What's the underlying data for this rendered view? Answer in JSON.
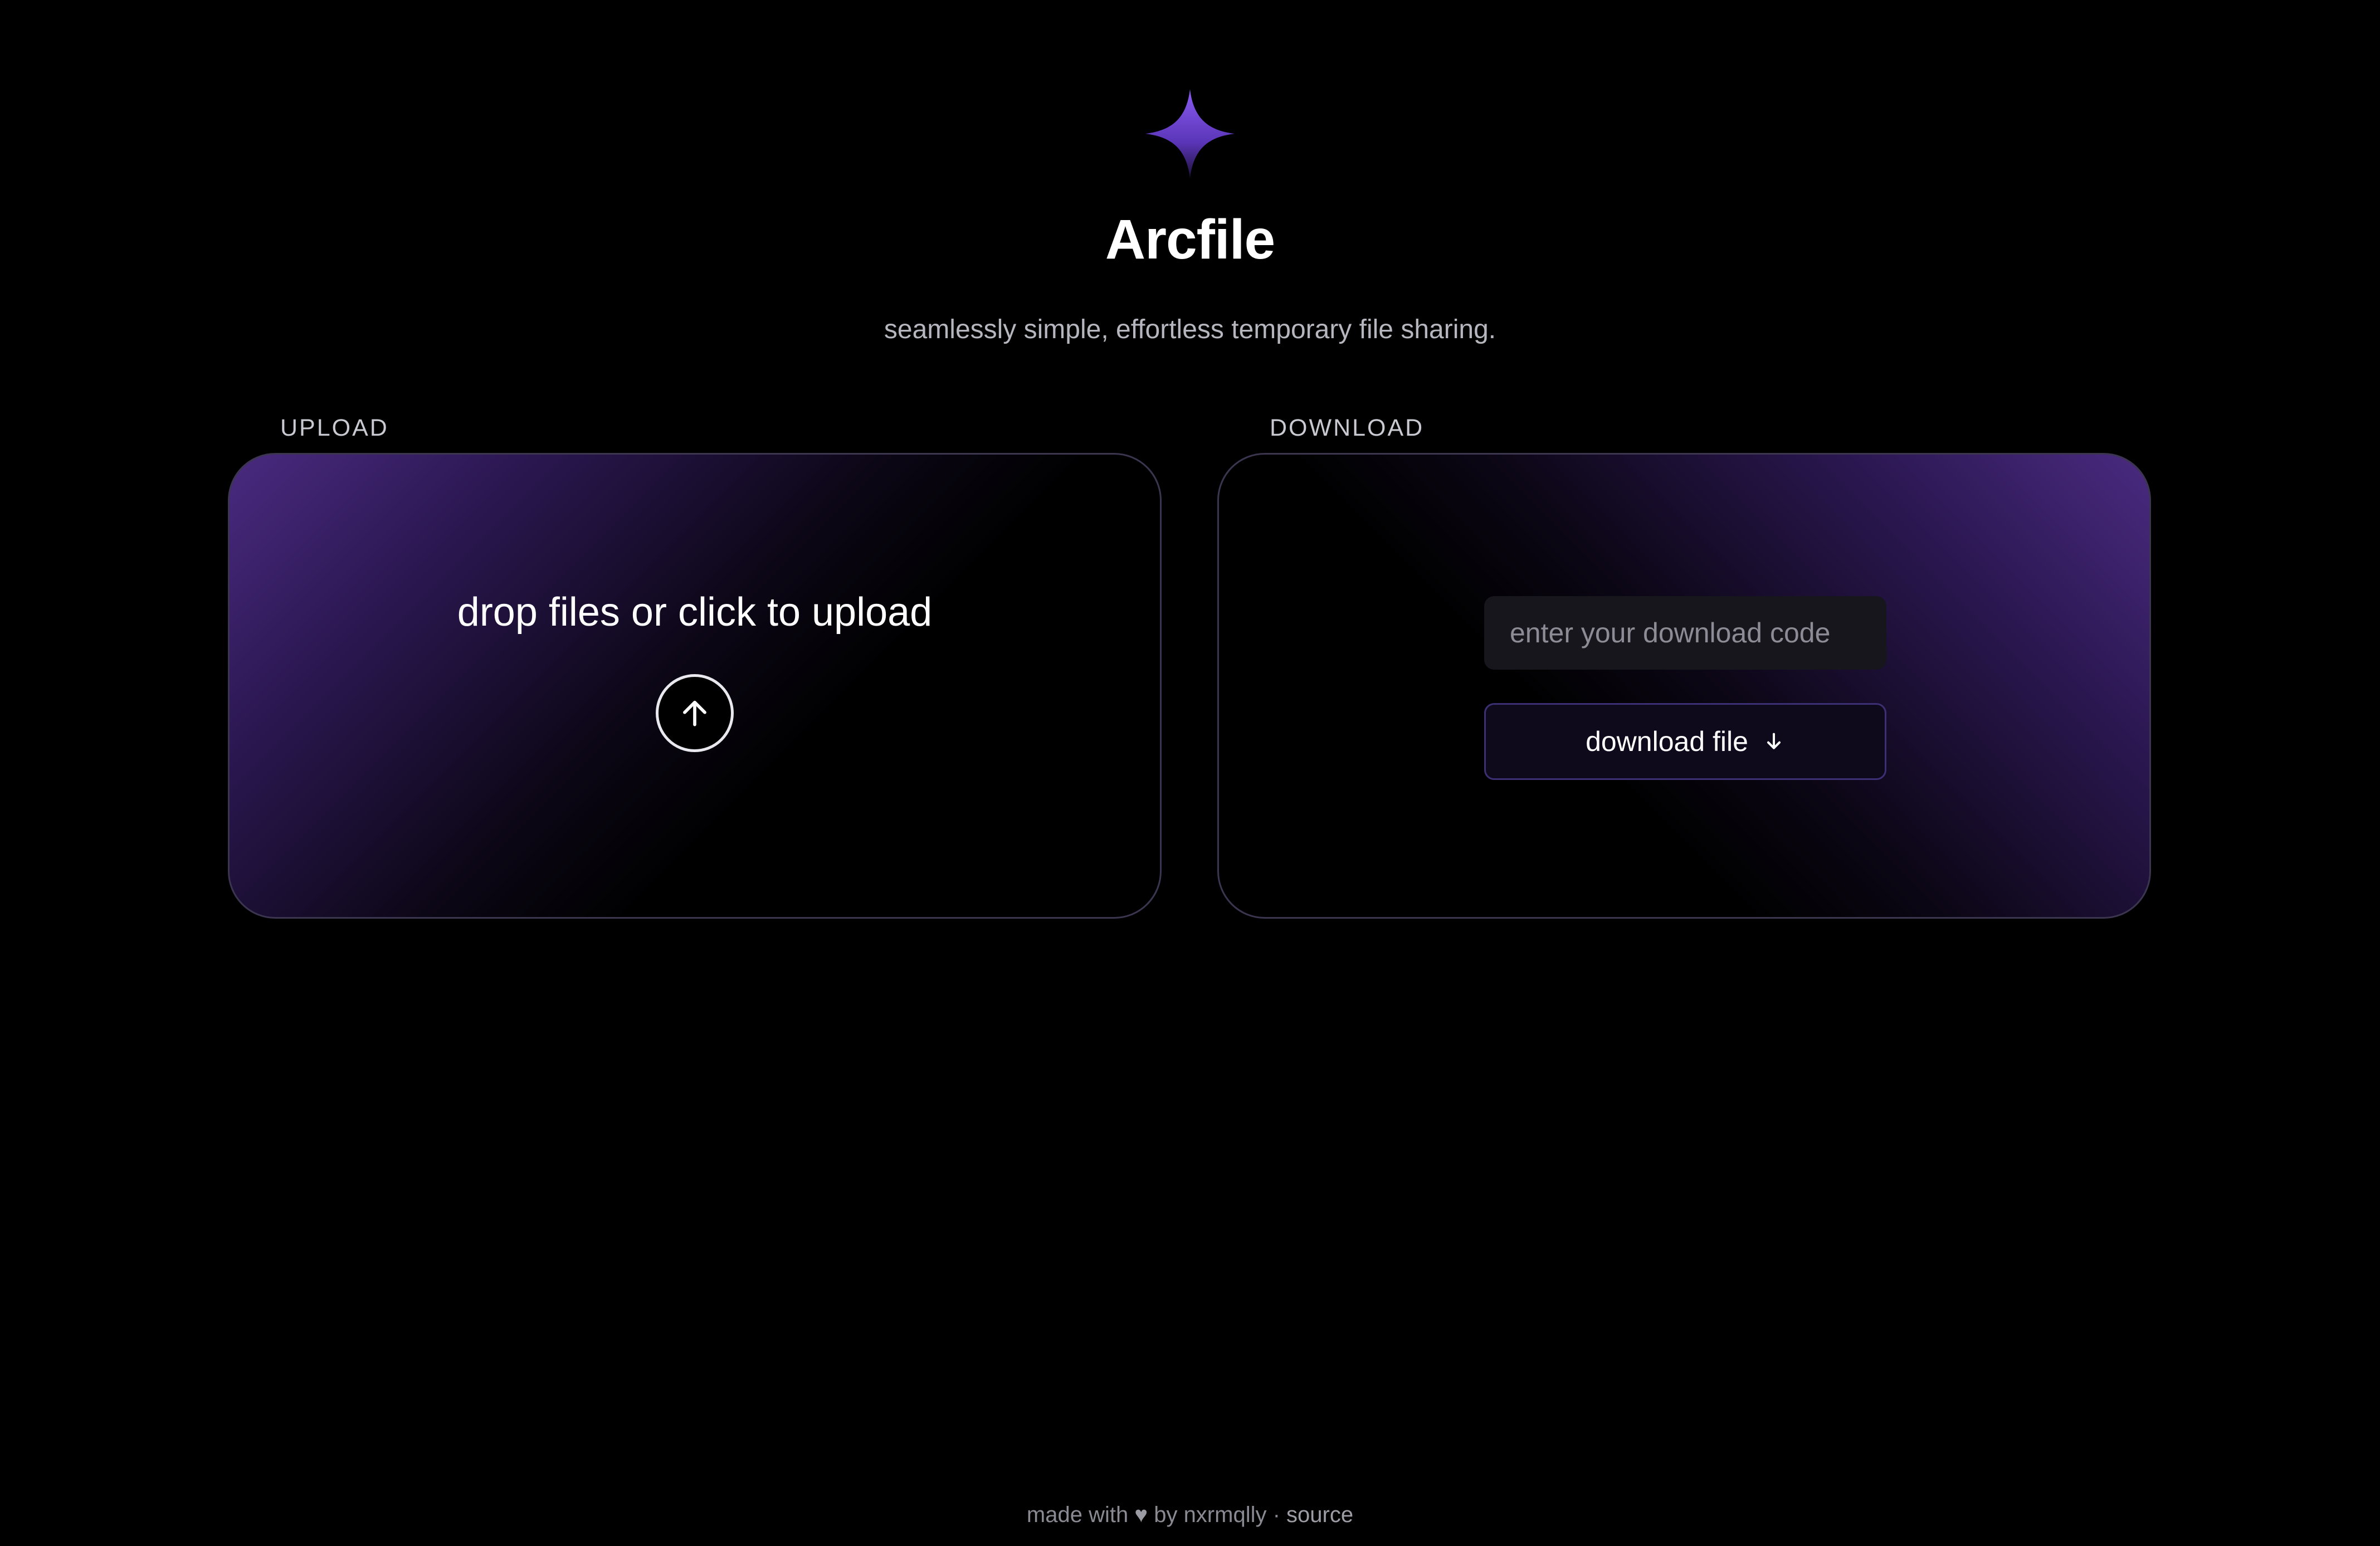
{
  "app": {
    "title": "Arcfile",
    "subtitle": "seamlessly simple, effortless temporary file sharing.",
    "logo_icon": "sparkle-icon",
    "accent_color": "#7b4fe0"
  },
  "upload": {
    "label": "UPLOAD",
    "prompt": "drop files or click to upload",
    "button_icon": "arrow-up-icon"
  },
  "download": {
    "label": "DOWNLOAD",
    "input_placeholder": "enter your download code",
    "input_value": "",
    "button_label": "download file",
    "button_icon": "arrow-down-icon"
  },
  "footer": {
    "made_with": "made with",
    "heart": "♥",
    "by": "by nxrmqlly",
    "separator": "·",
    "source_link": "source"
  }
}
